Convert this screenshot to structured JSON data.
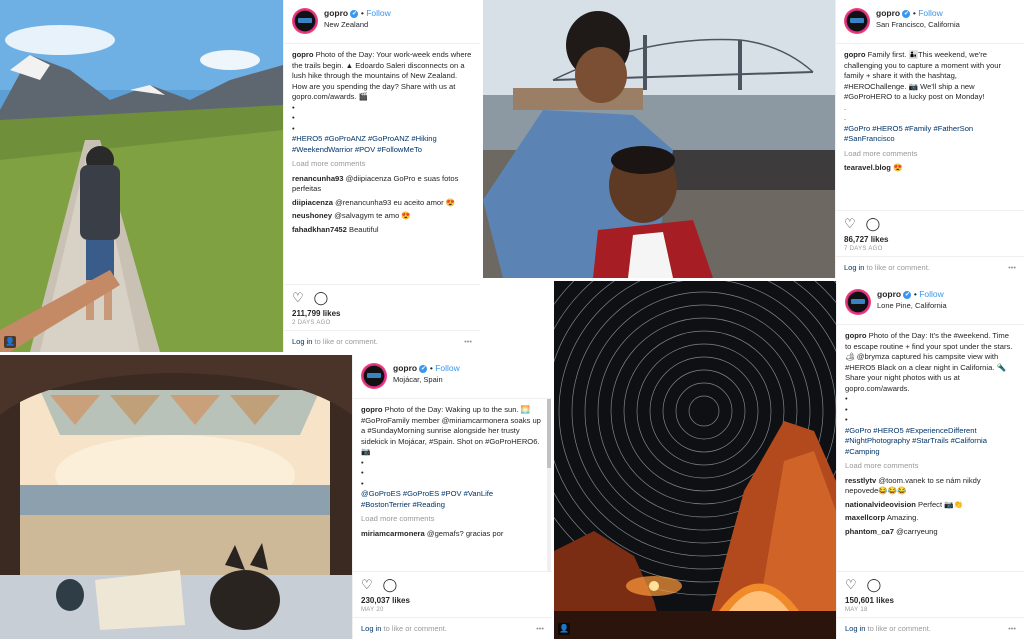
{
  "posts": [
    {
      "username": "gopro",
      "verified_mark": "✔",
      "follow": "Follow",
      "location": "New Zealand",
      "caption_lines": [
        "Photo of the Day: Your work-week ends where the trails begin. ▲ Edoardo Saleri disconnects on a lush hike through the mountains of New Zealand. How are you spending the day? Share with us at gopro.com/awards. 🎬"
      ],
      "hashtags": "#HERO5 #GoProANZ #GoProANZ #Hiking #WeekendWarrior #POV #FollowMeTo",
      "load_more": "Load more comments",
      "comments": [
        {
          "user": "renancunha93",
          "text": "@diipiacenza GoPro e suas fotos perfeitas"
        },
        {
          "user": "diipiacenza",
          "text": "@renancunha93 eu aceito amor 😍"
        },
        {
          "user": "neushoney",
          "text": "@salvagym te amo 😍"
        },
        {
          "user": "fahadkhan7452",
          "text": "Beautiful"
        }
      ],
      "likes": "211,799 likes",
      "date": "2 DAYS AGO",
      "login": "Log in",
      "login_rest": " to like or comment.",
      "dots": "•••"
    },
    {
      "username": "gopro",
      "verified_mark": "✔",
      "follow": "Follow",
      "location": "San Francisco, California",
      "caption_lines": [
        "Family first. 👨‍👦This weekend, we're challenging you to capture a moment with your family + share it with the hashtag, #HEROChallenge. 📷 We'll ship a new #GoProHERO to a lucky post on Monday!"
      ],
      "hashtags": "#GoPro #HERO5 #Family #FatherSon #SanFrancisco",
      "load_more": "Load more comments",
      "comments": [
        {
          "user": "tearavel.blog",
          "text": "😍"
        }
      ],
      "likes": "86,727 likes",
      "date": "7 DAYS AGO",
      "login": "Log in",
      "login_rest": " to like or comment.",
      "dots": "•••"
    },
    {
      "username": "gopro",
      "verified_mark": "✔",
      "follow": "Follow",
      "location": "Mojácar, Spain",
      "caption_lines": [
        "Photo of the Day: Waking up to the sun. 🌅 #GoProFamily member @miriamcarmonera soaks up a #SundayMorning sunrise alongside her trusty sidekick in Mojácar, #Spain. Shot on #GoProHERO6. 📷"
      ],
      "hashtags": "@GoProES #GoProES #POV #VanLife #BostonTerrier #Reading",
      "load_more": "Load more comments",
      "comments": [
        {
          "user": "miriamcarmonera",
          "text": "@gemafs? gracias por"
        }
      ],
      "likes": "230,037 likes",
      "date": "MAY 20",
      "login": "Log in",
      "login_rest": " to like or comment.",
      "dots": "•••"
    },
    {
      "username": "gopro",
      "verified_mark": "✔",
      "follow": "Follow",
      "location": "Lone Pine, California",
      "caption_lines": [
        "Photo of the Day: It's the #weekend. Time to escape routine + find your spot under the stars. 🏕 @brymza captured his campsite view with #HERO5 Black on a clear night in California. 🔦 Share your night photos with us at gopro.com/awards."
      ],
      "hashtags": "#GoPro #HERO5 #ExperienceDifferent #NightPhotography #StarTrails #California #Camping",
      "load_more": "Load more comments",
      "comments": [
        {
          "user": "resstlytv",
          "text": "@toom.vanek to se nám nikdy nepovede😂😂😂"
        },
        {
          "user": "nationalvideovision",
          "text": "Perfect 📷👏"
        },
        {
          "user": "maxellcorp",
          "text": "Amazing."
        },
        {
          "user": "phantom_ca7",
          "text": "@carryeung"
        }
      ],
      "likes": "150,601 likes",
      "date": "MAY 18",
      "login": "Log in",
      "login_rest": " to like or comment.",
      "dots": "•••"
    }
  ],
  "icons": {
    "heart": "heart-icon",
    "comment": "comment-icon",
    "user_tag": "user-tag-icon"
  }
}
